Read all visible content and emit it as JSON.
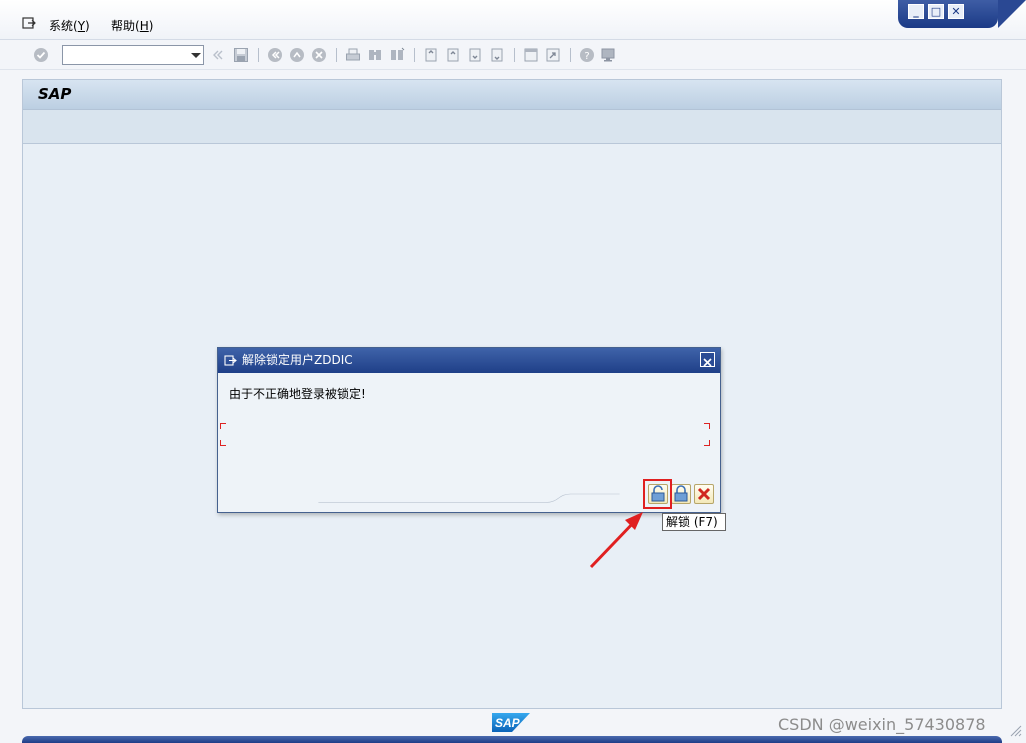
{
  "menubar": {
    "items": [
      {
        "label": "系统",
        "shortcut": "Y"
      },
      {
        "label": "帮助",
        "shortcut": "H"
      }
    ]
  },
  "toolbar": {
    "command_field_value": ""
  },
  "main": {
    "title": "SAP"
  },
  "dialog": {
    "title": "解除锁定用户ZDDIC",
    "message": "由于不正确地登录被锁定!",
    "buttons": [
      {
        "name": "unlock",
        "icon": "unlock-icon"
      },
      {
        "name": "lock",
        "icon": "lock-icon"
      },
      {
        "name": "cancel",
        "icon": "cancel-icon"
      }
    ]
  },
  "tooltip": {
    "text": "解锁  (F7)"
  },
  "footer": {
    "logo_text": "SAP",
    "watermark": "CSDN @weixin_57430878"
  },
  "colors": {
    "accent_blue": "#1f3f88",
    "highlight_red": "#e02020",
    "frame_bg": "#e8eff6"
  }
}
